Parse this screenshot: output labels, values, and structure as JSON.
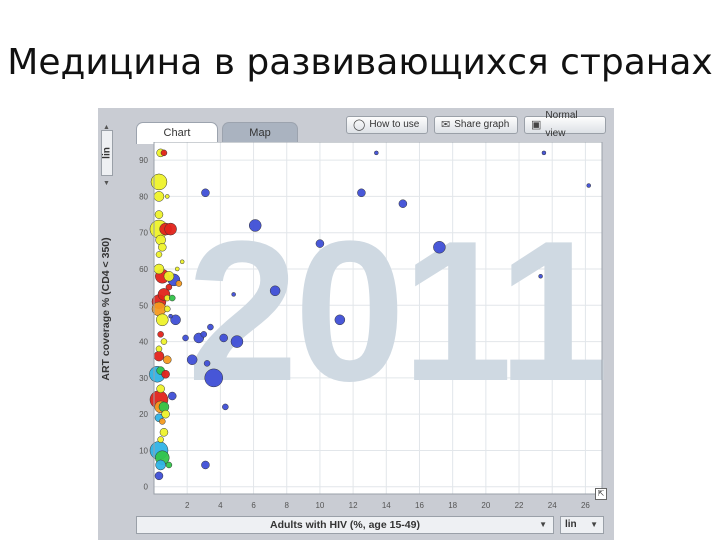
{
  "slide": {
    "title": "Медицина в развивающихся странах"
  },
  "tabs": [
    {
      "label": "Chart"
    },
    {
      "label": "Map"
    }
  ],
  "toolbar": {
    "how_to_use": "How to use",
    "share_graph": "Share graph",
    "normal_view": "Normal view"
  },
  "colors": {
    "plot_bg": "#ffffff",
    "frame_bg": "#c9ccd3",
    "year_watermark": "#cfd9e2",
    "grid": "#e2e6ea",
    "blue": "#3f4fd6",
    "red": "#e2231a",
    "yellow": "#eef22a",
    "orange": "#f59a1f",
    "cyan": "#2fb3e6",
    "green": "#33c44a"
  },
  "icons": {
    "how_to_use": "lightbulb-icon",
    "share_graph": "envelope-icon",
    "normal_view": "screen-icon",
    "expand": "expand-icon"
  },
  "chart_data": {
    "type": "scatter",
    "year_label": "2011",
    "xlabel": "Adults with HIV (%, age 15-49)",
    "ylabel": "ART coverage % (CD4 < 350)",
    "x_scale": "lin",
    "y_scale": "lin",
    "xlim": [
      0,
      27
    ],
    "ylim": [
      -2,
      95
    ],
    "x_ticks": [
      2,
      4,
      6,
      8,
      10,
      12,
      14,
      16,
      18,
      20,
      22,
      24,
      26
    ],
    "y_ticks": [
      0,
      10,
      20,
      30,
      40,
      50,
      60,
      70,
      80,
      90
    ],
    "grid": true,
    "points": [
      {
        "x": 0.4,
        "y": 92,
        "r": 4,
        "c": "yellow"
      },
      {
        "x": 0.6,
        "y": 92,
        "r": 3,
        "c": "red"
      },
      {
        "x": 0.3,
        "y": 84,
        "r": 8,
        "c": "yellow"
      },
      {
        "x": 0.3,
        "y": 80,
        "r": 5,
        "c": "yellow"
      },
      {
        "x": 0.8,
        "y": 80,
        "r": 2,
        "c": "yellow"
      },
      {
        "x": 0.3,
        "y": 75,
        "r": 4,
        "c": "yellow"
      },
      {
        "x": 0.3,
        "y": 71,
        "r": 9,
        "c": "yellow"
      },
      {
        "x": 0.7,
        "y": 71,
        "r": 6,
        "c": "red"
      },
      {
        "x": 1.0,
        "y": 71,
        "r": 6,
        "c": "red"
      },
      {
        "x": 0.4,
        "y": 68,
        "r": 5,
        "c": "yellow"
      },
      {
        "x": 0.5,
        "y": 66,
        "r": 4,
        "c": "yellow"
      },
      {
        "x": 0.3,
        "y": 64,
        "r": 3,
        "c": "yellow"
      },
      {
        "x": 0.3,
        "y": 60,
        "r": 5,
        "c": "yellow"
      },
      {
        "x": 0.5,
        "y": 58,
        "r": 7,
        "c": "red"
      },
      {
        "x": 0.9,
        "y": 58,
        "r": 5,
        "c": "yellow"
      },
      {
        "x": 1.4,
        "y": 60,
        "r": 2,
        "c": "yellow"
      },
      {
        "x": 1.7,
        "y": 62,
        "r": 2,
        "c": "yellow"
      },
      {
        "x": 1.2,
        "y": 57,
        "r": 6,
        "c": "blue"
      },
      {
        "x": 0.9,
        "y": 55,
        "r": 3,
        "c": "red"
      },
      {
        "x": 1.5,
        "y": 56,
        "r": 3,
        "c": "orange"
      },
      {
        "x": 0.6,
        "y": 53,
        "r": 6,
        "c": "red"
      },
      {
        "x": 0.3,
        "y": 51,
        "r": 7,
        "c": "red"
      },
      {
        "x": 0.8,
        "y": 52,
        "r": 3,
        "c": "yellow"
      },
      {
        "x": 1.1,
        "y": 52,
        "r": 3,
        "c": "green"
      },
      {
        "x": 0.3,
        "y": 49,
        "r": 7,
        "c": "orange"
      },
      {
        "x": 0.5,
        "y": 46,
        "r": 6,
        "c": "yellow"
      },
      {
        "x": 0.8,
        "y": 49,
        "r": 3,
        "c": "yellow"
      },
      {
        "x": 1.3,
        "y": 46,
        "r": 5,
        "c": "blue"
      },
      {
        "x": 0.4,
        "y": 42,
        "r": 3,
        "c": "red"
      },
      {
        "x": 0.6,
        "y": 40,
        "r": 3,
        "c": "yellow"
      },
      {
        "x": 0.3,
        "y": 38,
        "r": 3,
        "c": "yellow"
      },
      {
        "x": 0.3,
        "y": 36,
        "r": 5,
        "c": "red"
      },
      {
        "x": 0.8,
        "y": 35,
        "r": 4,
        "c": "orange"
      },
      {
        "x": 0.4,
        "y": 32,
        "r": 4,
        "c": "green"
      },
      {
        "x": 0.2,
        "y": 31,
        "r": 8,
        "c": "cyan"
      },
      {
        "x": 0.7,
        "y": 31,
        "r": 4,
        "c": "red"
      },
      {
        "x": 0.4,
        "y": 27,
        "r": 4,
        "c": "yellow"
      },
      {
        "x": 0.3,
        "y": 24,
        "r": 9,
        "c": "red"
      },
      {
        "x": 0.4,
        "y": 22,
        "r": 6,
        "c": "orange"
      },
      {
        "x": 0.6,
        "y": 22,
        "r": 5,
        "c": "green"
      },
      {
        "x": 0.3,
        "y": 19,
        "r": 4,
        "c": "cyan"
      },
      {
        "x": 0.7,
        "y": 20,
        "r": 4,
        "c": "yellow"
      },
      {
        "x": 0.5,
        "y": 18,
        "r": 3,
        "c": "orange"
      },
      {
        "x": 0.6,
        "y": 15,
        "r": 4,
        "c": "yellow"
      },
      {
        "x": 0.4,
        "y": 13,
        "r": 3,
        "c": "yellow"
      },
      {
        "x": 0.3,
        "y": 10,
        "r": 9,
        "c": "cyan"
      },
      {
        "x": 0.5,
        "y": 8,
        "r": 7,
        "c": "green"
      },
      {
        "x": 0.4,
        "y": 6,
        "r": 5,
        "c": "cyan"
      },
      {
        "x": 0.3,
        "y": 3,
        "r": 4,
        "c": "blue"
      },
      {
        "x": 0.9,
        "y": 6,
        "r": 3,
        "c": "green"
      },
      {
        "x": 2.3,
        "y": 35,
        "r": 5,
        "c": "blue"
      },
      {
        "x": 1.9,
        "y": 41,
        "r": 3,
        "c": "blue"
      },
      {
        "x": 3.0,
        "y": 42,
        "r": 3,
        "c": "blue"
      },
      {
        "x": 3.4,
        "y": 44,
        "r": 3,
        "c": "blue"
      },
      {
        "x": 3.2,
        "y": 34,
        "r": 3,
        "c": "blue"
      },
      {
        "x": 3.6,
        "y": 30,
        "r": 9,
        "c": "blue"
      },
      {
        "x": 1.1,
        "y": 25,
        "r": 4,
        "c": "blue"
      },
      {
        "x": 2.7,
        "y": 41,
        "r": 5,
        "c": "blue"
      },
      {
        "x": 4.2,
        "y": 41,
        "r": 4,
        "c": "blue"
      },
      {
        "x": 5.0,
        "y": 40,
        "r": 6,
        "c": "blue"
      },
      {
        "x": 3.1,
        "y": 81,
        "r": 4,
        "c": "blue"
      },
      {
        "x": 3.1,
        "y": 6,
        "r": 4,
        "c": "blue"
      },
      {
        "x": 4.3,
        "y": 22,
        "r": 3,
        "c": "blue"
      },
      {
        "x": 4.8,
        "y": 53,
        "r": 2,
        "c": "blue"
      },
      {
        "x": 6.1,
        "y": 72,
        "r": 6,
        "c": "blue"
      },
      {
        "x": 7.3,
        "y": 54,
        "r": 5,
        "c": "blue"
      },
      {
        "x": 10.0,
        "y": 67,
        "r": 4,
        "c": "blue"
      },
      {
        "x": 12.5,
        "y": 81,
        "r": 4,
        "c": "blue"
      },
      {
        "x": 13.4,
        "y": 92,
        "r": 2,
        "c": "blue"
      },
      {
        "x": 11.2,
        "y": 46,
        "r": 5,
        "c": "blue"
      },
      {
        "x": 15.0,
        "y": 78,
        "r": 4,
        "c": "blue"
      },
      {
        "x": 17.2,
        "y": 66,
        "r": 6,
        "c": "blue"
      },
      {
        "x": 23.5,
        "y": 92,
        "r": 2,
        "c": "blue"
      },
      {
        "x": 23.3,
        "y": 58,
        "r": 2,
        "c": "blue"
      },
      {
        "x": 26.2,
        "y": 83,
        "r": 2,
        "c": "blue"
      },
      {
        "x": 1.0,
        "y": 47,
        "r": 2,
        "c": "blue"
      }
    ]
  }
}
